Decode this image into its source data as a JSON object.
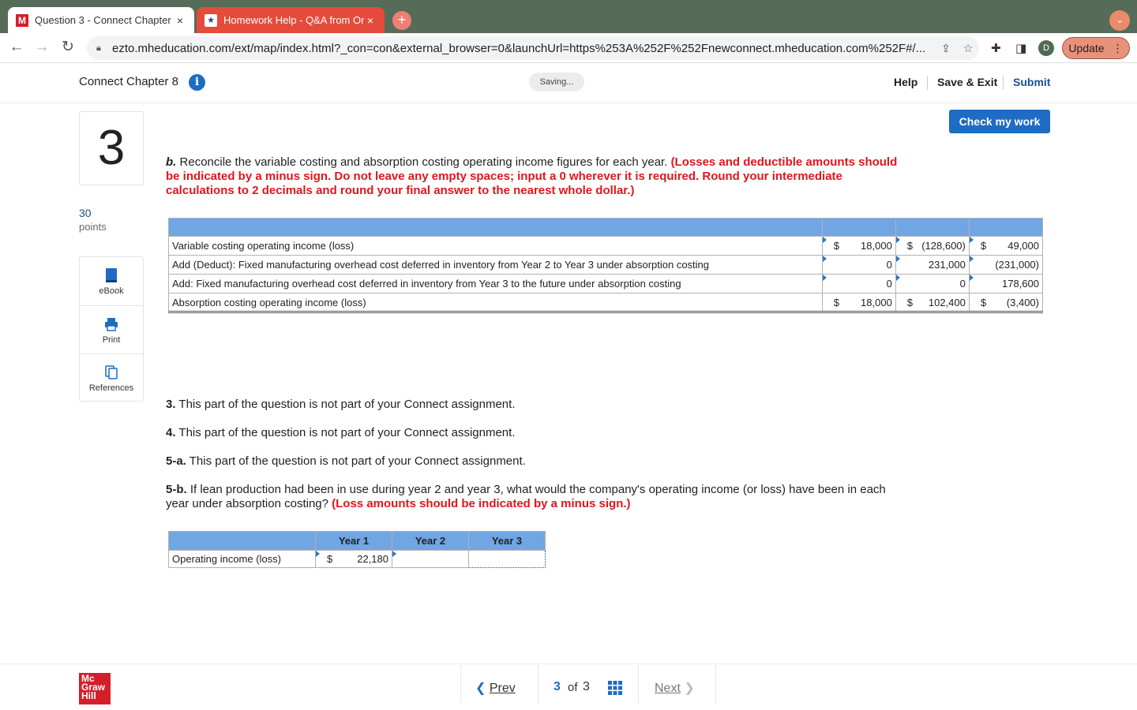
{
  "browser": {
    "tabs": [
      {
        "favicon": "M",
        "title": "Question 3 - Connect Chapter",
        "close": "×"
      },
      {
        "favicon": "★",
        "title": "Homework Help - Q&A from Or",
        "close": "×"
      }
    ],
    "new_tab": "+",
    "url": "ezto.mheducation.com/ext/map/index.html?_con=con&external_browser=0&launchUrl=https%253A%252F%252Fnewconnect.mheducation.com%252F#/...",
    "profile_initial": "D",
    "update_label": "Update"
  },
  "header": {
    "title": "Connect Chapter 8",
    "status": "Saving...",
    "help": "Help",
    "save_exit": "Save & Exit",
    "submit": "Submit"
  },
  "sidebar": {
    "question_number": "3",
    "points_value": "30",
    "points_label": "points",
    "tools": [
      {
        "label": "eBook",
        "icon": "book-icon"
      },
      {
        "label": "Print",
        "icon": "print-icon"
      },
      {
        "label": "References",
        "icon": "references-icon"
      }
    ]
  },
  "check_button": "Check my work",
  "part_b": {
    "label": "b.",
    "text": "Reconcile the variable costing and absorption costing operating income figures for each year.",
    "instructions": "(Losses and deductible amounts should be indicated by a minus sign. Do not leave any empty spaces; input a 0 wherever it is required. Round your intermediate calculations to 2 decimals and round your final answer to the nearest whole dollar.)"
  },
  "reconcile_table": {
    "rows": [
      {
        "label": "Variable costing operating income (loss)",
        "cells": [
          {
            "cur": "$",
            "v": "18,000"
          },
          {
            "cur": "$",
            "v": "(128,600)"
          },
          {
            "cur": "$",
            "v": "49,000"
          }
        ]
      },
      {
        "label": "Add (Deduct): Fixed manufacturing overhead cost deferred in inventory from Year 2 to Year 3 under absorption costing",
        "cells": [
          {
            "cur": "",
            "v": "0"
          },
          {
            "cur": "",
            "v": "231,000"
          },
          {
            "cur": "",
            "v": "(231,000)"
          }
        ]
      },
      {
        "label": "Add: Fixed manufacturing overhead cost deferred in inventory from Year 3 to the future under absorption costing",
        "cells": [
          {
            "cur": "",
            "v": "0"
          },
          {
            "cur": "",
            "v": "0"
          },
          {
            "cur": "",
            "v": "178,600"
          }
        ]
      },
      {
        "label": "Absorption costing operating income (loss)",
        "cells": [
          {
            "cur": "$",
            "v": "18,000"
          },
          {
            "cur": "$",
            "v": "102,400"
          },
          {
            "cur": "$",
            "v": "(3,400)"
          }
        ]
      }
    ]
  },
  "parts": [
    {
      "label": "3.",
      "text": "This part of the question is not part of your Connect assignment."
    },
    {
      "label": "4.",
      "text": "This part of the question is not part of your Connect assignment."
    },
    {
      "label": "5-a.",
      "text": "This part of the question is not part of your Connect assignment."
    }
  ],
  "part_5b": {
    "label": "5-b.",
    "text": "If lean production had been in use during year 2 and year 3, what would the company's operating income (or loss) have been in each year under absorption costing?",
    "instructions": "(Loss amounts should be indicated by a minus sign.)"
  },
  "income_table": {
    "headers": [
      "Year 1",
      "Year 2",
      "Year 3"
    ],
    "row_label": "Operating income (loss)",
    "year1_cur": "$",
    "year1_value": "22,180",
    "year2_value": "",
    "year3_value": ""
  },
  "footer": {
    "logo_lines": [
      "Mc",
      "Graw",
      "Hill"
    ],
    "prev": "Prev",
    "current": "3",
    "of": "of",
    "total": "3",
    "next": "Next"
  }
}
